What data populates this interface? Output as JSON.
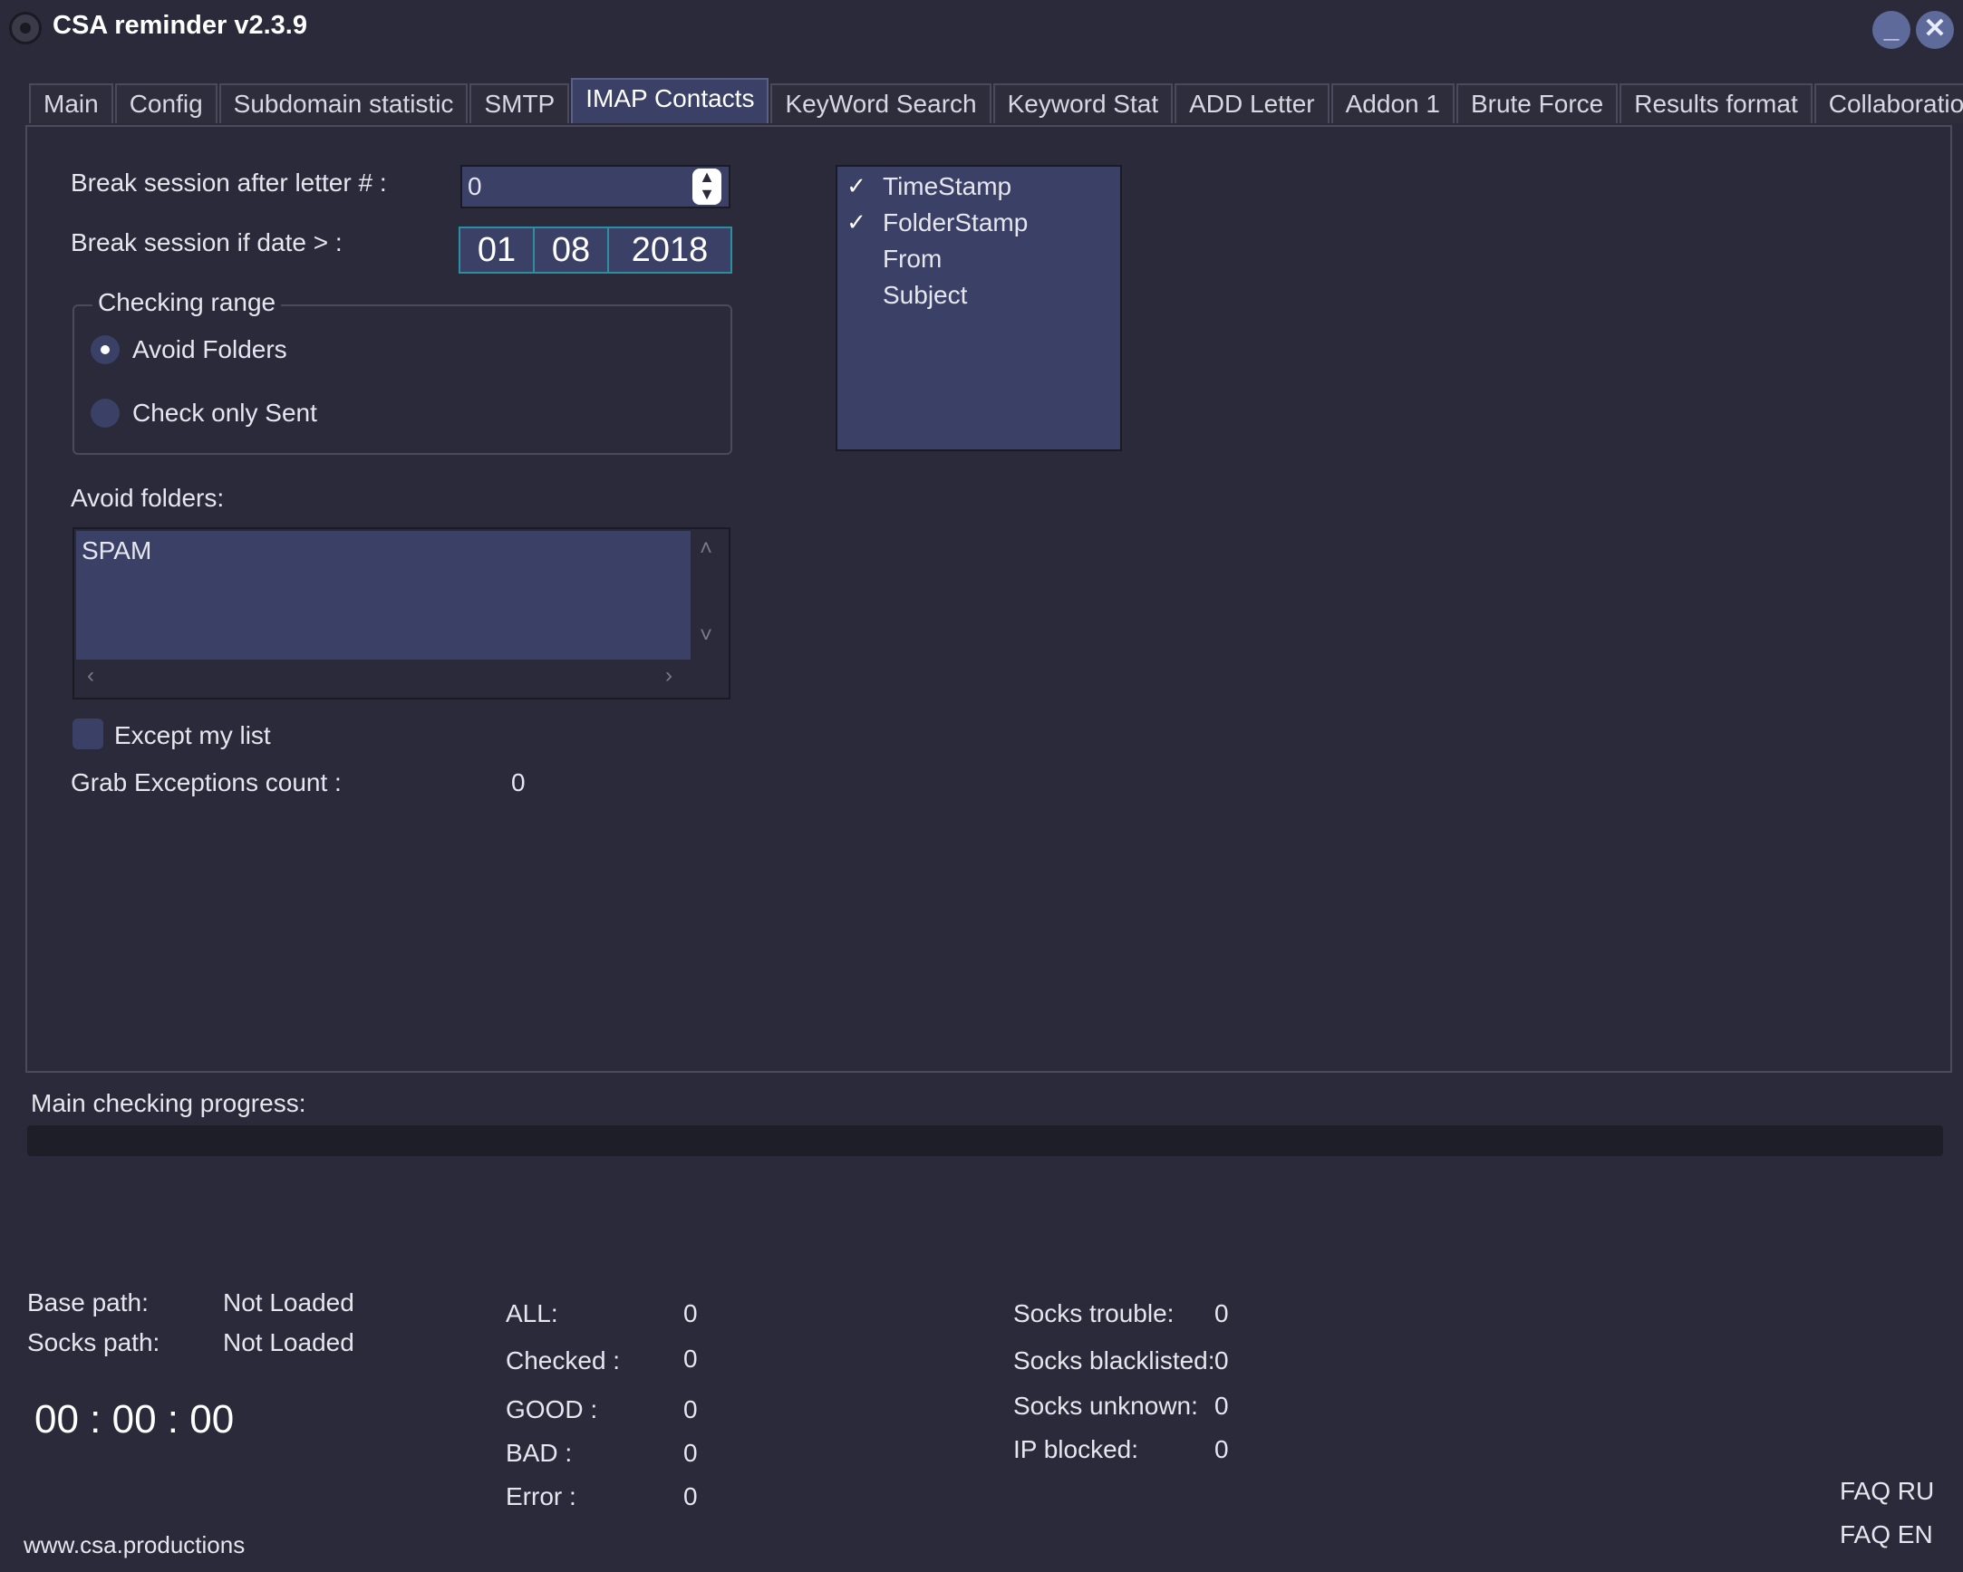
{
  "window": {
    "title": "CSA reminder v2.3.9",
    "minimize_glyph": "_",
    "close_glyph": "✕"
  },
  "tabs": [
    {
      "label": "Main"
    },
    {
      "label": "Config"
    },
    {
      "label": "Subdomain statistic"
    },
    {
      "label": "SMTP"
    },
    {
      "label": "IMAP Contacts"
    },
    {
      "label": "KeyWord Search"
    },
    {
      "label": "Keyword Stat"
    },
    {
      "label": "ADD Letter"
    },
    {
      "label": "Addon 1"
    },
    {
      "label": "Brute Force"
    },
    {
      "label": "Results format"
    },
    {
      "label": "Collaboration"
    }
  ],
  "active_tab": "IMAP Contacts",
  "imap": {
    "break_letter_label": "Break session after letter # :",
    "break_letter_value": "0",
    "break_date_label": "Break session if date > :",
    "date": {
      "day": "01",
      "month": "08",
      "year": "2018"
    },
    "checking_range": {
      "title": "Checking range",
      "options": [
        {
          "label": "Avoid Folders",
          "selected": true
        },
        {
          "label": "Check only Sent",
          "selected": false
        }
      ]
    },
    "avoid_folders_label": "Avoid folders:",
    "avoid_folders_value": "SPAM",
    "except_label": "Except my list",
    "except_checked": false,
    "grab_label": "Grab Exceptions count :",
    "grab_value": "0",
    "fields": [
      {
        "label": "TimeStamp",
        "checked": true
      },
      {
        "label": "FolderStamp",
        "checked": true
      },
      {
        "label": "From",
        "checked": false
      },
      {
        "label": "Subject",
        "checked": false
      }
    ]
  },
  "progress": {
    "label": "Main checking progress:",
    "percent": 0
  },
  "paths": {
    "base_label": "Base path:",
    "base_value": "Not Loaded",
    "socks_label": "Socks path:",
    "socks_value": "Not Loaded"
  },
  "timer": "00 : 00 : 00",
  "stats": {
    "all_label": "ALL:",
    "all": "0",
    "checked_label": "Checked :",
    "checked": "0",
    "good_label": "GOOD :",
    "good": "0",
    "bad_label": "BAD :",
    "bad": "0",
    "error_label": "Error :",
    "error": "0"
  },
  "socks": {
    "trouble_label": "Socks trouble:",
    "trouble": "0",
    "blacklisted_label": "Socks blacklisted:",
    "blacklisted": "0",
    "unknown_label": "Socks unknown:",
    "unknown": "0",
    "ipblocked_label": "IP blocked:",
    "ipblocked": "0"
  },
  "links": {
    "website": "www.csa.productions",
    "faq_ru": "FAQ RU",
    "faq_en": "FAQ EN"
  },
  "colors": {
    "background": "#2a2a3a",
    "field": "#3a4066",
    "accent_border": "#2c8fa0",
    "window_button": "#5d6a9a"
  }
}
